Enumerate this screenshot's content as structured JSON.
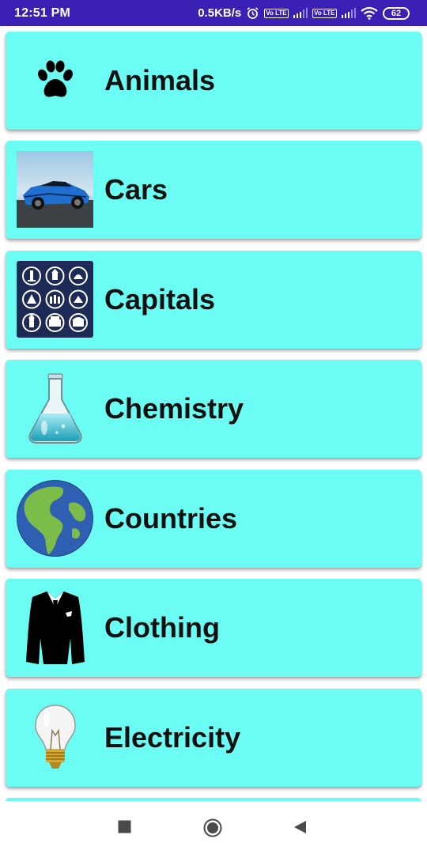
{
  "status_bar": {
    "time": "12:51 PM",
    "net_speed": "0.5KB/s",
    "volte_1": "Vo LTE",
    "volte_2": "Vo LTE",
    "battery": "62",
    "icons": [
      "alarm-icon",
      "signal-icon",
      "wifi-icon",
      "battery-icon"
    ]
  },
  "categories": [
    {
      "label": "Animals",
      "icon": "paw-icon"
    },
    {
      "label": "Cars",
      "icon": "car-photo-icon"
    },
    {
      "label": "Capitals",
      "icon": "landmarks-icon"
    },
    {
      "label": "Chemistry",
      "icon": "flask-icon"
    },
    {
      "label": "Countries",
      "icon": "globe-icon"
    },
    {
      "label": "Clothing",
      "icon": "suit-icon"
    },
    {
      "label": "Electricity",
      "icon": "light-bulb-icon"
    }
  ],
  "nav_bar": {
    "icons": [
      "recents-square-icon",
      "home-circle-icon",
      "back-triangle-icon"
    ]
  },
  "colors": {
    "status_bar": "#3a1fb4",
    "card_background": "#6bfdf3"
  }
}
